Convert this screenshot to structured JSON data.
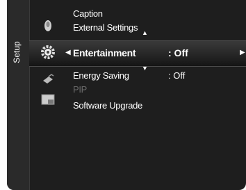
{
  "sidebar": {
    "label": "Setup"
  },
  "menu": {
    "items": [
      {
        "label": "Caption"
      },
      {
        "label": "External Settings"
      },
      {
        "label": "Entertainment",
        "value": ": Off"
      },
      {
        "label": "Energy Saving",
        "value": ": Off"
      },
      {
        "label": "PIP"
      },
      {
        "label": "Software Upgrade"
      }
    ]
  },
  "icons": [
    "picture-icon",
    "setup-gear-icon",
    "satellite-icon",
    "pip-icon"
  ],
  "colors": {
    "background": "#1e1e1e",
    "text": "#ffffff",
    "disabled": "#6a6a6a"
  }
}
